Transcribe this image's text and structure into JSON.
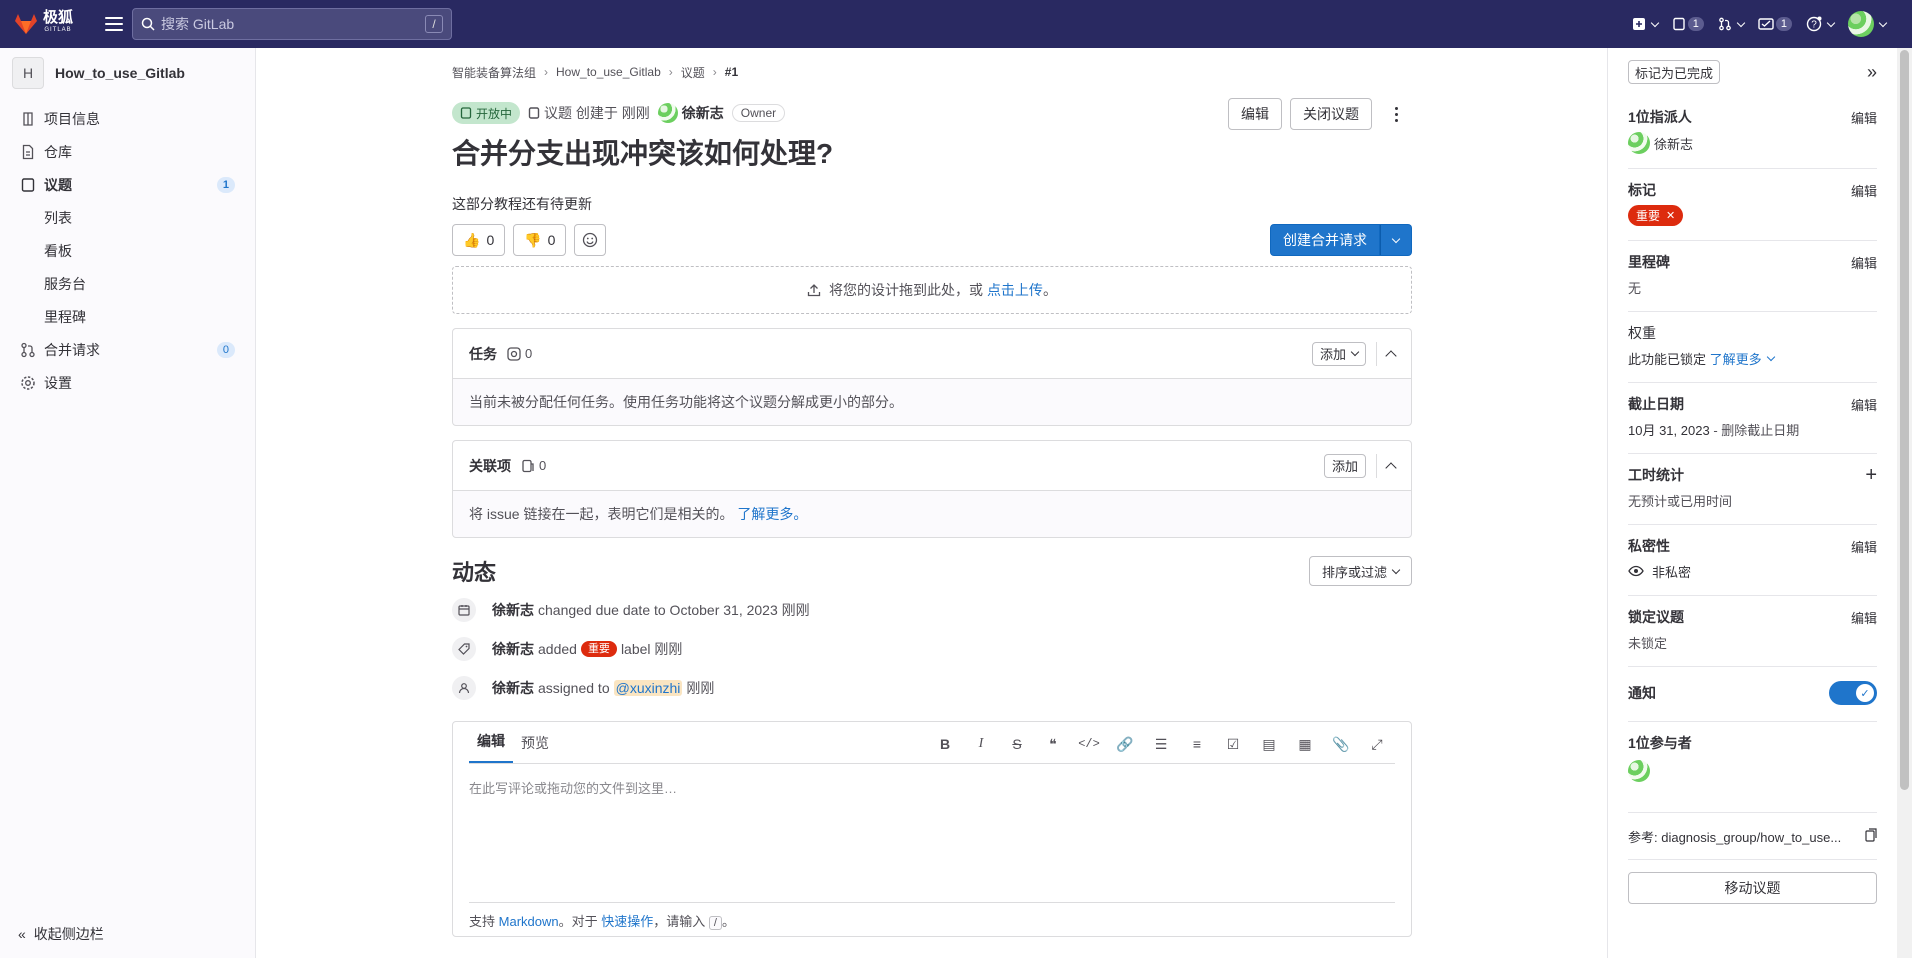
{
  "topbar": {
    "logo_text": "极狐",
    "logo_sub": "GITLAB",
    "search_placeholder": "搜索 GitLab",
    "search_shortcut": "/",
    "issues_count": "1",
    "todos_count": "1"
  },
  "sidebar": {
    "project_initial": "H",
    "project_name": "How_to_use_Gitlab",
    "items": [
      {
        "label": "项目信息"
      },
      {
        "label": "仓库"
      },
      {
        "label": "议题",
        "count": "1"
      },
      {
        "label": "合并请求",
        "count": "0"
      },
      {
        "label": "设置"
      }
    ],
    "subitems": [
      "列表",
      "看板",
      "服务台",
      "里程碑"
    ],
    "collapse_label": "收起侧边栏"
  },
  "breadcrumb": [
    "智能装备算法组",
    "How_to_use_Gitlab",
    "议题",
    "#1"
  ],
  "issue": {
    "status": "开放中",
    "type_label": "议题",
    "created_text": "创建于",
    "created_time": "刚刚",
    "author": "徐新志",
    "author_role": "Owner",
    "edit_label": "编辑",
    "close_label": "关闭议题",
    "title": "合并分支出现冲突该如何处理?",
    "description": "这部分教程还有待更新",
    "thumbs_up": "0",
    "thumbs_down": "0",
    "create_mr_label": "创建合并请求",
    "upload_text": "将您的设计拖到此处，或",
    "upload_link": "点击上传",
    "upload_end": "。"
  },
  "tasks": {
    "title": "任务",
    "count": "0",
    "add_label": "添加",
    "empty_text": "当前未被分配任何任务。使用任务功能将这个议题分解成更小的部分。"
  },
  "linked": {
    "title": "关联项",
    "count": "0",
    "add_label": "添加",
    "text": "将 issue 链接在一起，表明它们是相关的。",
    "link": "了解更多。"
  },
  "activity": {
    "title": "动态",
    "sort_label": "排序或过滤",
    "events": [
      {
        "user": "徐新志",
        "text": "changed due date to October 31, 2023",
        "time": "刚刚"
      },
      {
        "user": "徐新志",
        "text_before": "added",
        "label": "重要",
        "text_after": "label",
        "time": "刚刚"
      },
      {
        "user": "徐新志",
        "text_before": "assigned to",
        "mention": "@xuxinzhi",
        "time": "刚刚"
      }
    ]
  },
  "editor": {
    "tab_edit": "编辑",
    "tab_preview": "预览",
    "placeholder": "在此写评论或拖动您的文件到这里…",
    "footer_prefix": "支持",
    "footer_markdown": "Markdown",
    "footer_mid": "。对于",
    "footer_quick": "快速操作",
    "footer_suffix": "，请输入",
    "footer_kbd": "/",
    "footer_end": "。"
  },
  "right_sidebar": {
    "todo_label": "标记为已完成",
    "assignee_title": "1位指派人",
    "assignee_name": "徐新志",
    "labels_title": "标记",
    "label_name": "重要",
    "milestone_title": "里程碑",
    "milestone_value": "无",
    "weight_title": "权重",
    "weight_value": "此功能已锁定",
    "weight_link": "了解更多",
    "due_title": "截止日期",
    "due_value": "10月 31, 2023",
    "due_remove": "- 删除截止日期",
    "time_title": "工时统计",
    "time_value": "无预计或已用时间",
    "conf_title": "私密性",
    "conf_value": "非私密",
    "lock_title": "锁定议题",
    "lock_value": "未锁定",
    "notify_title": "通知",
    "participants_title": "1位参与者",
    "reference": "参考: diagnosis_group/how_to_use...",
    "move_label": "移动议题",
    "edit_label": "编辑"
  },
  "colors": {
    "topbar": "#292961",
    "primary": "#1f75cb",
    "danger": "#dd2b0e",
    "status_open": "#c3e6cd"
  }
}
